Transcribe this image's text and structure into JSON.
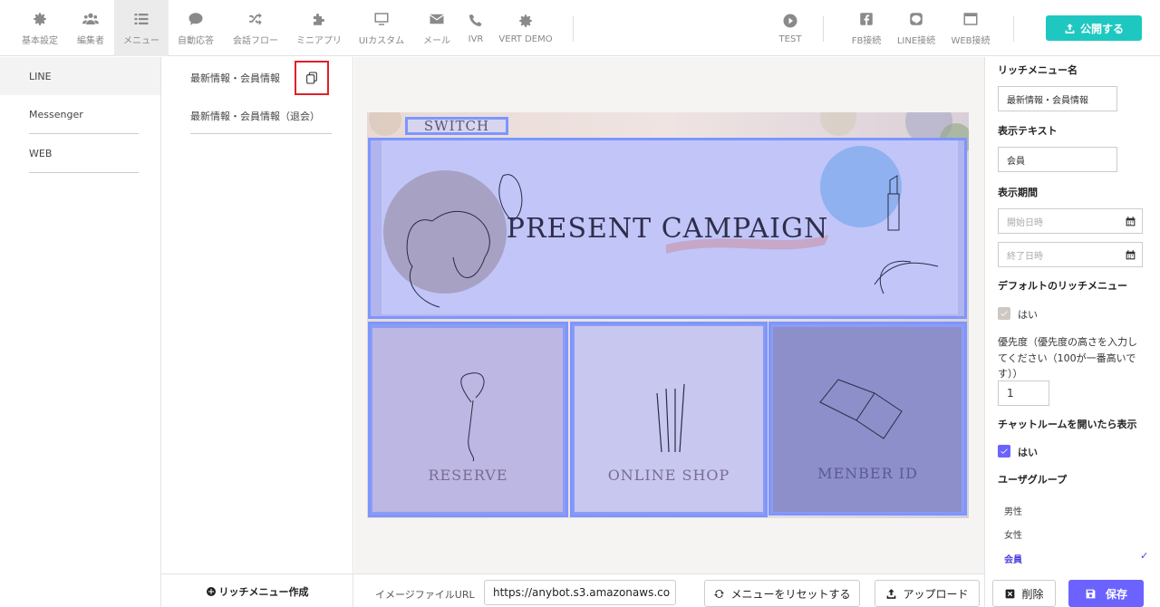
{
  "nav": {
    "items": [
      {
        "label": "基本設定",
        "icon": "gear-icon"
      },
      {
        "label": "編集者",
        "icon": "users-icon"
      },
      {
        "label": "メニュー",
        "icon": "list-icon"
      },
      {
        "label": "自動応答",
        "icon": "chat-icon"
      },
      {
        "label": "会話フロー",
        "icon": "shuffle-icon"
      },
      {
        "label": "ミニアプリ",
        "icon": "puzzle-icon"
      },
      {
        "label": "UIカスタム",
        "icon": "monitor-icon"
      },
      {
        "label": "メール",
        "icon": "envelope-icon"
      },
      {
        "label": "IVR",
        "icon": "phone-icon"
      },
      {
        "label": "VERT DEMO",
        "icon": "gear-icon"
      }
    ],
    "right_items": [
      {
        "label": "TEST",
        "icon": "play-icon"
      },
      {
        "label": "FB接続",
        "icon": "facebook-icon"
      },
      {
        "label": "LINE接続",
        "icon": "line-icon"
      },
      {
        "label": "WEB接続",
        "icon": "browser-icon"
      }
    ],
    "publish_label": "公開する"
  },
  "channels": [
    "LINE",
    "Messenger",
    "WEB"
  ],
  "menus": [
    "最新情報・会員情報",
    "最新情報・会員情報（退会）"
  ],
  "rich_menu": {
    "switch_label": "SWITCH",
    "banner_title": "PRESENT CAMPAIGN",
    "tiles": [
      "RESERVE",
      "ONLINE SHOP",
      "MENBER ID"
    ]
  },
  "panel": {
    "name_label": "リッチメニュー名",
    "name_value": "最新情報・会員情報",
    "display_text_label": "表示テキスト",
    "display_text_value": "会員",
    "period_label": "表示期間",
    "start_placeholder": "開始日時",
    "end_placeholder": "終了日時",
    "default_label": "デフォルトのリッチメニュー",
    "default_yes": "はい",
    "priority_label_1": "優先度（優先度の高さを入力し",
    "priority_label_2": "てください（100が一番高いで",
    "priority_label_3": "す））",
    "priority_value": "1",
    "chatroom_label": "チャットルームを開いたら表示",
    "chatroom_yes": "はい",
    "user_group_label": "ユーザグループ",
    "groups": [
      "男性",
      "女性",
      "会員"
    ],
    "selected_group_mark": "✓"
  },
  "bottom": {
    "create_label": "リッチメニュー作成",
    "url_label": "イメージファイルURL",
    "url_value": "https://anybot.s3.amazonaws.co",
    "reset_label": "メニューをリセットする",
    "upload_label": "アップロード",
    "delete_label": "削除",
    "save_label": "保存"
  },
  "colors": {
    "accent": "#6c63ff",
    "publish": "#1ec8c0",
    "highlight": "#e0202a",
    "overlay": "#7c96ff"
  }
}
